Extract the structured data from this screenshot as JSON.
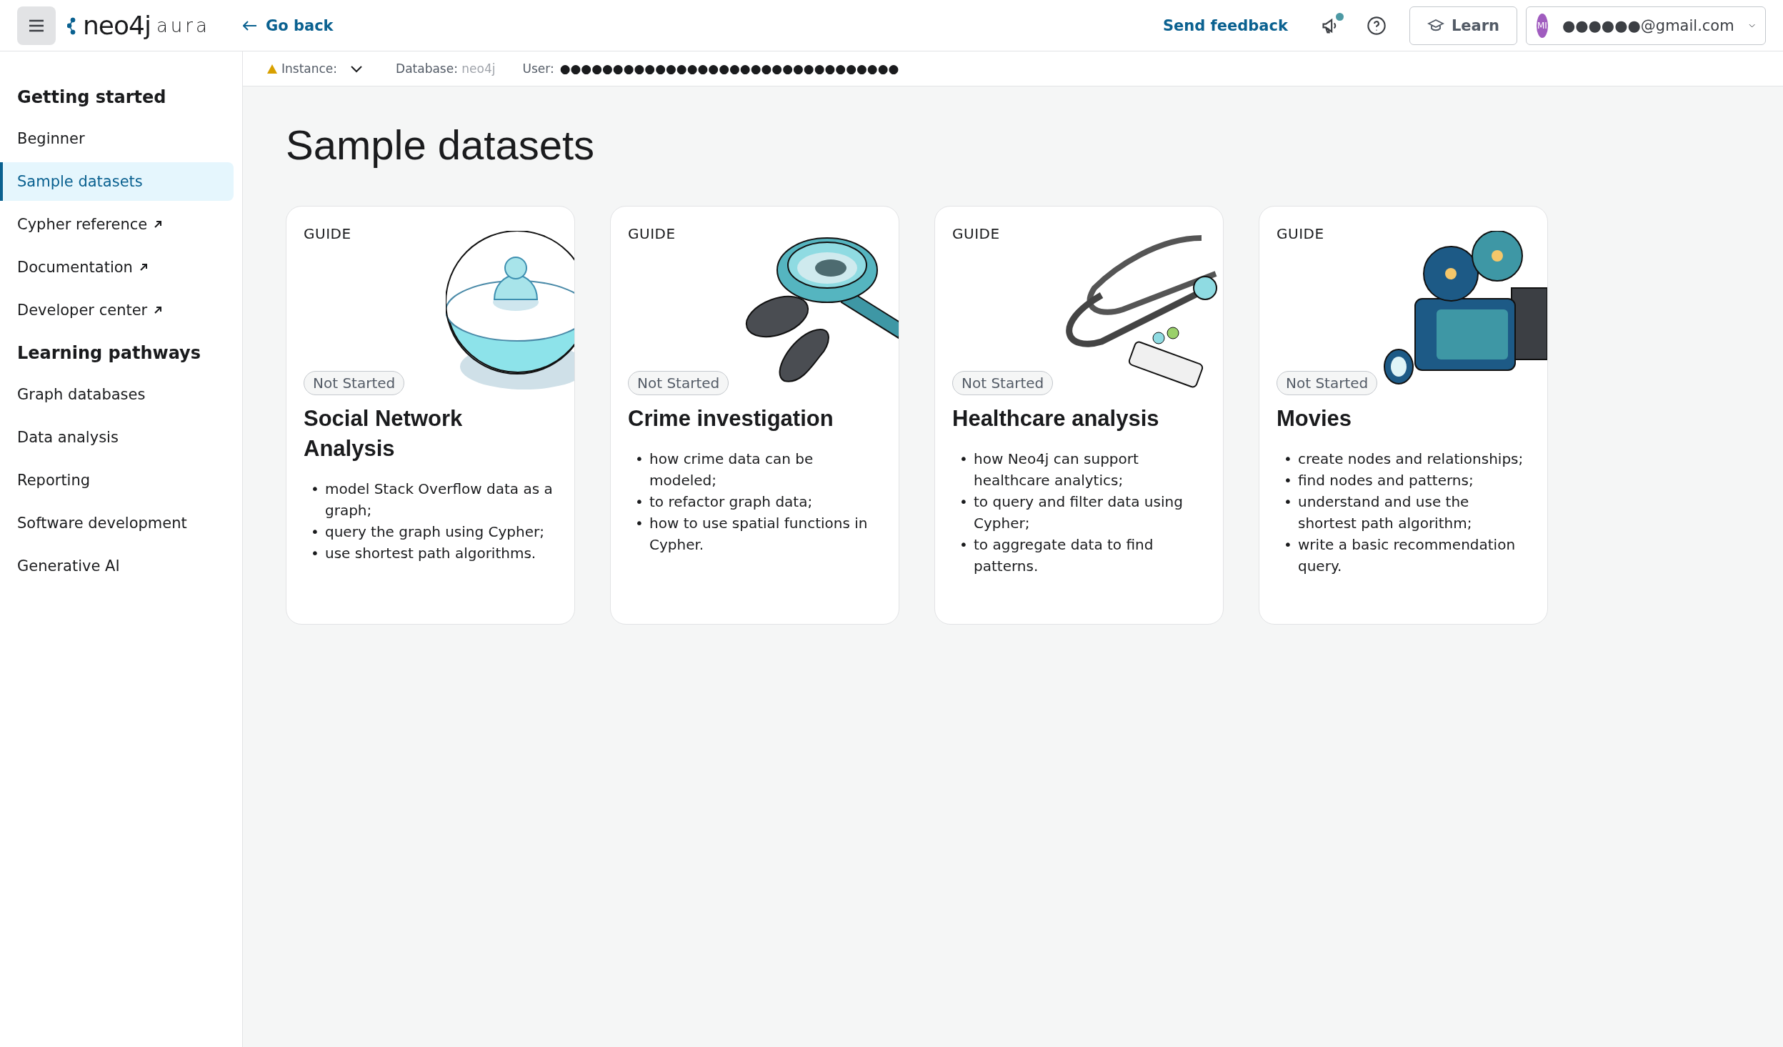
{
  "topbar": {
    "logo": {
      "brand": "neo4j",
      "product": "aura"
    },
    "back_link": "Go back",
    "feedback_link": "Send feedback",
    "notification_dot": true,
    "learn_button": "Learn",
    "account": {
      "initials": "MI",
      "email": "●●●●●●@gmail.com"
    }
  },
  "context_bar": {
    "instance_label": "Instance:",
    "instance_warning": true,
    "database_label": "Database:",
    "database_value": "neo4j",
    "user_label": "User:",
    "user_value": "●●●●●●●●●●●●●●●●●●●●●●●●●●●●●●●●"
  },
  "sidebar": {
    "sections": [
      {
        "heading": "Getting started",
        "items": [
          {
            "label": "Beginner",
            "external": false,
            "selected": false
          },
          {
            "label": "Sample datasets",
            "external": false,
            "selected": true
          },
          {
            "label": "Cypher reference",
            "external": true,
            "selected": false
          },
          {
            "label": "Documentation",
            "external": true,
            "selected": false
          },
          {
            "label": "Developer center",
            "external": true,
            "selected": false
          }
        ]
      },
      {
        "heading": "Learning pathways",
        "items": [
          {
            "label": "Graph databases",
            "external": false,
            "selected": false
          },
          {
            "label": "Data analysis",
            "external": false,
            "selected": false
          },
          {
            "label": "Reporting",
            "external": false,
            "selected": false
          },
          {
            "label": "Software development",
            "external": false,
            "selected": false
          },
          {
            "label": "Generative AI",
            "external": false,
            "selected": false
          }
        ]
      }
    ]
  },
  "page_title": "Sample datasets",
  "cards": [
    {
      "tag": "GUIDE",
      "bullet": "•",
      "kind": "sphere",
      "status": "Not Started",
      "title": "Social Network Analysis",
      "points": [
        "model Stack Overflow data as a graph;",
        "query the graph using Cypher;",
        "use shortest path algorithms."
      ]
    },
    {
      "tag": "GUIDE",
      "bullet": "•",
      "kind": "magnifier",
      "status": "Not Started",
      "title": "Crime investigation",
      "points": [
        "how crime data can be modeled;",
        "to refactor graph data;",
        "how to use spatial functions in Cypher."
      ]
    },
    {
      "tag": "GUIDE",
      "bullet": "•",
      "kind": "stethoscope",
      "status": "Not Started",
      "title": "Healthcare analysis",
      "points": [
        "how Neo4j can support healthcare analytics;",
        "to query and filter data using Cypher;",
        "to aggregate data to find patterns."
      ]
    },
    {
      "tag": "GUIDE",
      "bullet": "•",
      "kind": "camera",
      "status": "Not Started",
      "title": "Movies",
      "points": [
        "create nodes and relationships;",
        "find nodes and patterns;",
        "understand and use the shortest path algorithm;",
        "write a basic recommendation query."
      ]
    }
  ]
}
